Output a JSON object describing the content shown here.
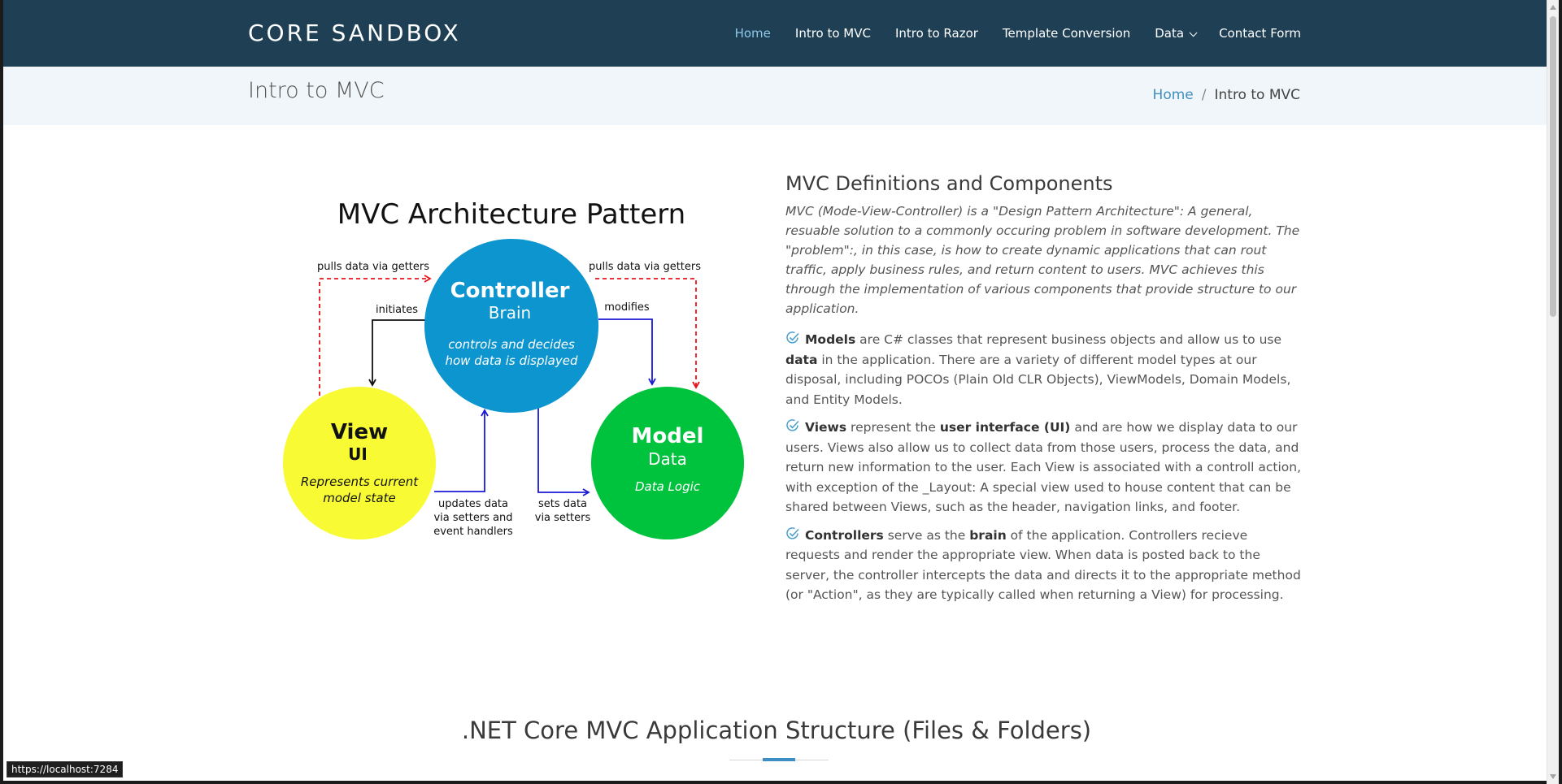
{
  "header": {
    "brand": "CORE SANDBOX",
    "nav": [
      {
        "label": "Home",
        "active": true
      },
      {
        "label": "Intro to MVC"
      },
      {
        "label": "Intro to Razor"
      },
      {
        "label": "Template Conversion"
      },
      {
        "label": "Data",
        "dropdown": true
      },
      {
        "label": "Contact Form"
      }
    ]
  },
  "page": {
    "title": "Intro to MVC",
    "breadcrumb": {
      "home": "Home",
      "separator": "/",
      "current": "Intro to MVC"
    }
  },
  "diagram": {
    "title": "MVC Architecture Pattern",
    "controller": {
      "name": "Controller",
      "role": "Brain",
      "desc1": "controls and decides",
      "desc2": "how data is displayed",
      "color": "#0d95cf"
    },
    "view": {
      "name": "View",
      "role": "UI",
      "desc1": "Represents current",
      "desc2": "model state",
      "color": "#f8fb33"
    },
    "model": {
      "name": "Model",
      "role": "Data",
      "desc": "Data Logic",
      "color": "#00c33d"
    },
    "labels": {
      "pulls_left": "pulls data via getters",
      "pulls_right": "pulls data via getters",
      "initiates": "initiates",
      "modifies": "modifies",
      "updates1": "updates data",
      "updates2": "via setters and",
      "updates3": "event handlers",
      "sets1": "sets data",
      "sets2": "via setters"
    }
  },
  "definitions": {
    "heading": "MVC Definitions and Components",
    "intro": "MVC (Mode-View-Controller) is a \"Design Pattern Architecture\": A general, resuable solution to a commonly occuring problem in software development. The \"problem\":, in this case, is how to create dynamic applications that can rout traffic, apply business rules, and return content to users. MVC achieves this through the implementation of various components that provide structure to our application.",
    "models": {
      "term": "Models",
      "t1": " are C# classes that represent business objects and allow us to use ",
      "bold2": "data",
      "t2": " in the application. There are a variety of different model types at our disposal, including POCOs (Plain Old CLR Objects), ViewModels, Domain Models, and Entity Models."
    },
    "views": {
      "term": "Views",
      "t1": " represent the ",
      "bold2": "user interface (UI)",
      "t2": " and are how we display data to our users. Views also allow us to collect data from those users, process the data, and return new information to the user. Each View is associated with a controll action, with exception of the _Layout: A special view used to house content that can be shared between Views, such as the header, navigation links, and footer."
    },
    "controllers": {
      "term": "Controllers",
      "t1": " serve as the ",
      "bold2": "brain",
      "t2": " of the application. Controllers recieve requests and render the appropriate view. When data is posted back to the server, the controller intercepts the data and directs it to the appropriate method (or \"Action\", as they are typically called when returning a View) for processing."
    }
  },
  "section": {
    "title": ".NET Core MVC Application Structure (Files & Folders)"
  },
  "status": {
    "url": "https://localhost:7284"
  },
  "colors": {
    "header_bg": "#1e3f54",
    "accent": "#3b8fc2",
    "check": "#4a9fd0"
  }
}
